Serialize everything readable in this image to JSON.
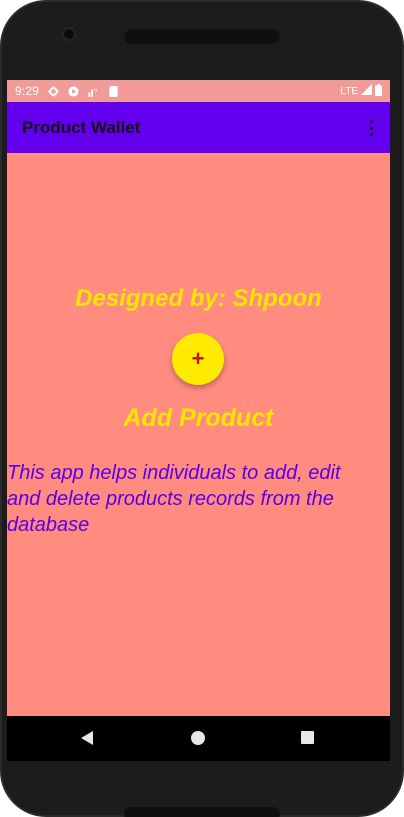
{
  "status_bar": {
    "time": "9:29",
    "network": "LTE",
    "icons": [
      "gear-icon",
      "play-protect-icon",
      "signal-question-icon",
      "sd-card-icon"
    ],
    "right_icons": [
      "signal-icon",
      "battery-icon"
    ]
  },
  "app_bar": {
    "title": "Product Wallet",
    "menu_icon": "more-vert-icon",
    "color": "#6200ee"
  },
  "main": {
    "designed_by": "Designed by: Shpoon",
    "fab_symbol": "+",
    "add_product": "Add Product",
    "description": "This app helps individuals to add, edit and delete products records from the database",
    "background_color": "#ff8c7f",
    "accent_color": "#ffe500",
    "description_color": "#5b00e6"
  },
  "nav_bar": {
    "buttons": [
      "back-icon",
      "home-icon",
      "recents-icon"
    ]
  }
}
